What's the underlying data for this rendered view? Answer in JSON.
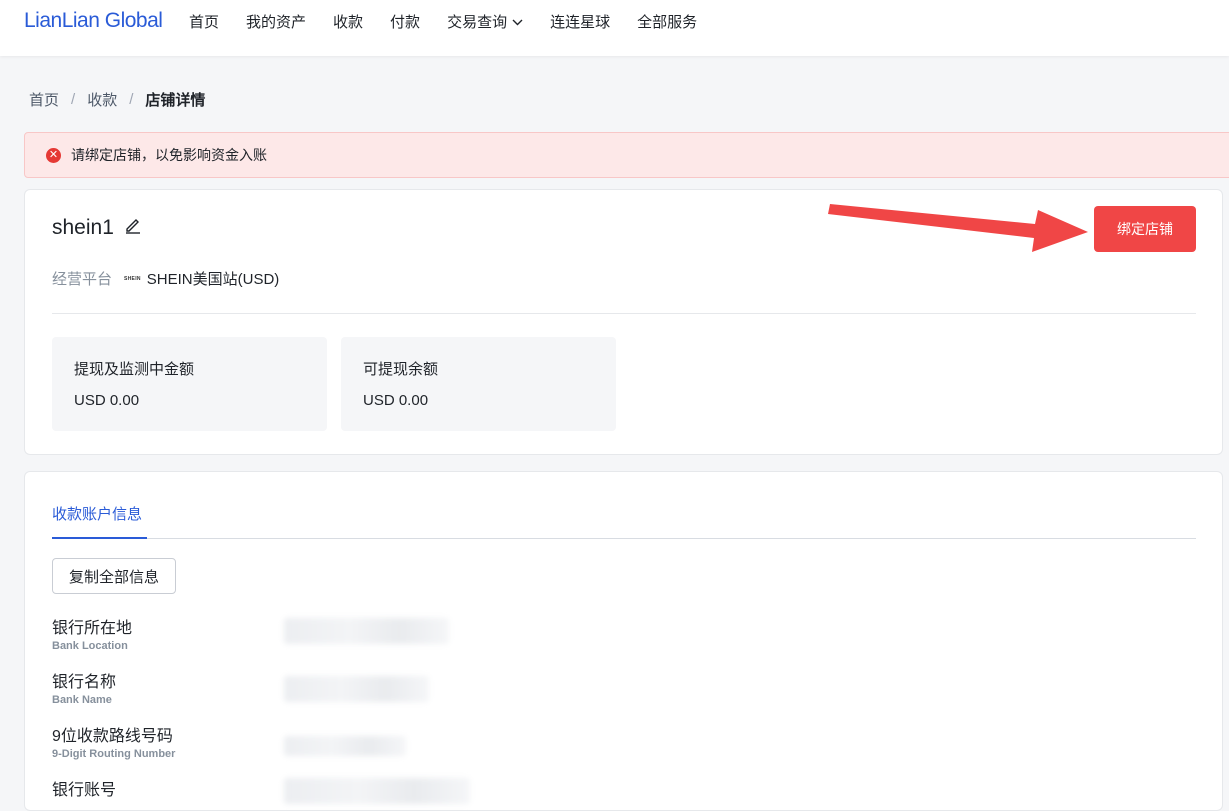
{
  "header": {
    "logo": "LianLian Global",
    "nav": [
      {
        "label": "首页"
      },
      {
        "label": "我的资产"
      },
      {
        "label": "收款"
      },
      {
        "label": "付款"
      },
      {
        "label": "交易查询"
      },
      {
        "label": "连连星球"
      },
      {
        "label": "全部服务"
      }
    ]
  },
  "breadcrumb": {
    "items": [
      "首页",
      "收款"
    ],
    "separator": "/",
    "current": "店铺详情"
  },
  "alert": {
    "icon": "error-circle-icon",
    "message": "请绑定店铺，以免影响资金入账",
    "color": "#e53935"
  },
  "store": {
    "name": "shein1",
    "platform_label": "经营平台",
    "platform_logo_text": "SHEIN",
    "platform_value": "SHEIN美国站(USD)",
    "bind_button": "绑定店铺",
    "bind_button_color": "#f04646",
    "stats": [
      {
        "label": "提现及监测中金额",
        "value": "USD 0.00"
      },
      {
        "label": "可提现余额",
        "value": "USD 0.00"
      }
    ]
  },
  "account": {
    "tab": "收款账户信息",
    "copy_button": "复制全部信息",
    "fields": [
      {
        "cn": "银行所在地",
        "en": "Bank Location"
      },
      {
        "cn": "银行名称",
        "en": "Bank Name"
      },
      {
        "cn": "9位收款路线号码",
        "en": "9-Digit Routing Number"
      },
      {
        "cn": "银行账号",
        "en": ""
      }
    ]
  },
  "theme": {
    "accent": "#2a5bd7",
    "danger": "#f04646"
  }
}
